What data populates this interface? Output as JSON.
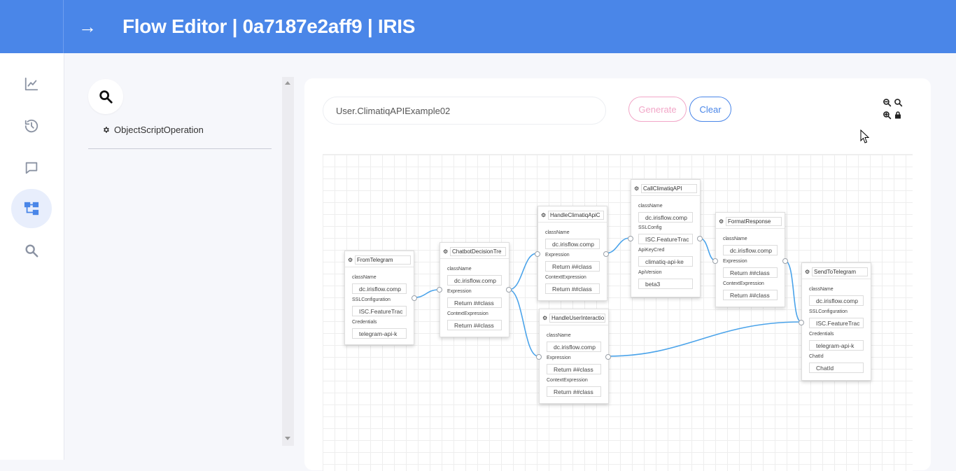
{
  "header": {
    "arrow_icon": "arrow-right-icon",
    "title": "Flow Editor | 0a7187e2aff9 | IRIS"
  },
  "rail": [
    {
      "name": "analytics",
      "icon": "chart-line-icon",
      "active": false
    },
    {
      "name": "history",
      "icon": "history-icon",
      "active": false
    },
    {
      "name": "messages",
      "icon": "chat-icon",
      "active": false
    },
    {
      "name": "flow",
      "icon": "flow-diagram-icon",
      "active": true
    },
    {
      "name": "search",
      "icon": "search-icon",
      "active": false
    }
  ],
  "palette": {
    "items": [
      {
        "label": "ObjectScriptOperation",
        "icon": "gear-icon"
      }
    ]
  },
  "editor": {
    "flow_name": "User.ClimatiqAPIExample02",
    "generate_label": "Generate",
    "clear_label": "Clear",
    "colors": {
      "accent": "#4a86e8",
      "generate": "#f2a7c8",
      "wire": "#4aa3ea"
    }
  },
  "nodes": [
    {
      "title": "FromTelegram",
      "fields": [
        {
          "label": "className",
          "value": "dc.irisflow.comp"
        },
        {
          "label": "SSLConfiguration",
          "value": "ISC.FeatureTrac"
        },
        {
          "label": "Credentials",
          "value": "telegram-api-k"
        }
      ]
    },
    {
      "title": "ChatbotDecisionTre",
      "fields": [
        {
          "label": "className",
          "value": "dc.irisflow.comp"
        },
        {
          "label": "Expression",
          "value": "Return ##class"
        },
        {
          "label": "ContextExpression",
          "value": "Return ##class"
        }
      ]
    },
    {
      "title": "HandleClimatiqApiC",
      "fields": [
        {
          "label": "className",
          "value": "dc.irisflow.comp"
        },
        {
          "label": "Expression",
          "value": "Return ##class"
        },
        {
          "label": "ContextExpression",
          "value": "Return ##class"
        }
      ]
    },
    {
      "title": "HandleUserInteractio",
      "fields": [
        {
          "label": "className",
          "value": "dc.irisflow.comp"
        },
        {
          "label": "Expression",
          "value": "Return ##class"
        },
        {
          "label": "ContextExpression",
          "value": "Return ##class"
        }
      ]
    },
    {
      "title": "CallClimatiqAPI",
      "fields": [
        {
          "label": "className",
          "value": "dc.irisflow.comp"
        },
        {
          "label": "SSLConfig",
          "value": "ISC.FeatureTrac"
        },
        {
          "label": "ApiKeyCred",
          "value": "climatiq-api-ke"
        },
        {
          "label": "ApiVersion",
          "value": "beta3"
        }
      ]
    },
    {
      "title": "FormatResponse",
      "fields": [
        {
          "label": "className",
          "value": "dc.irisflow.comp"
        },
        {
          "label": "Expression",
          "value": "Return ##class"
        },
        {
          "label": "ContextExpression",
          "value": "Return ##class"
        }
      ]
    },
    {
      "title": "SendToTelegram",
      "fields": [
        {
          "label": "className",
          "value": "dc.irisflow.comp"
        },
        {
          "label": "SSLConfiguration",
          "value": "ISC.FeatureTrac"
        },
        {
          "label": "Credentials",
          "value": "telegram-api-k"
        },
        {
          "label": "ChatId",
          "value": "ChatId"
        }
      ]
    }
  ]
}
